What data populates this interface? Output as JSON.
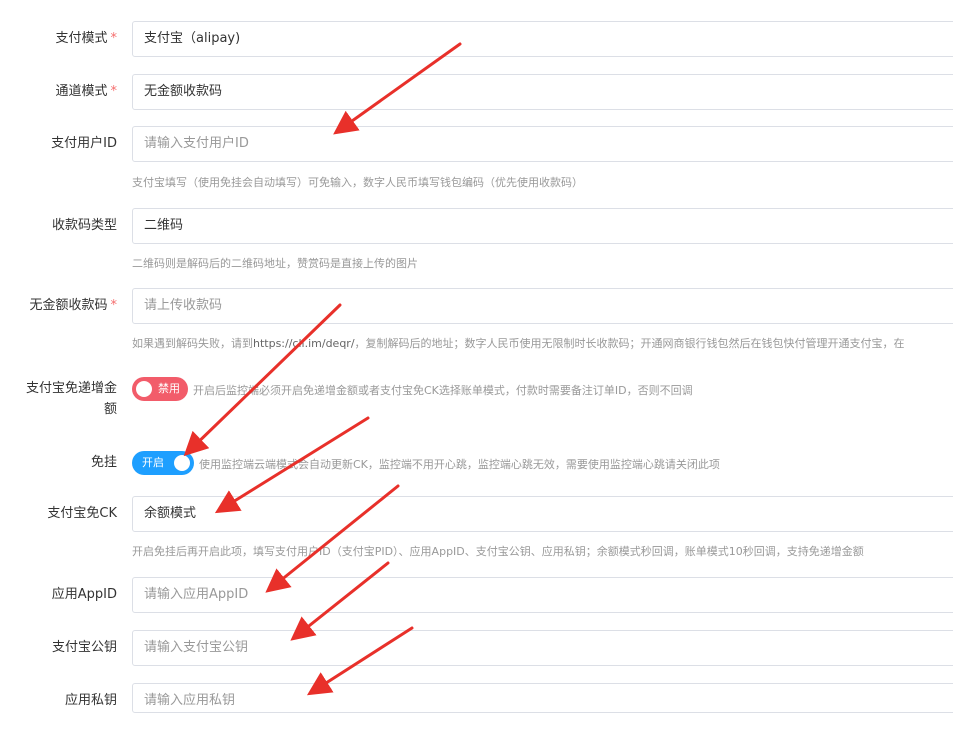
{
  "fields": {
    "pay_mode": {
      "label": "支付模式",
      "value": "支付宝（alipay)"
    },
    "channel_mode": {
      "label": "通道模式",
      "value": "无金额收款码"
    },
    "pay_user_id": {
      "label": "支付用户ID",
      "placeholder": "请输入支付用户ID",
      "help": "支付宝填写（使用免挂会自动填写）可免输入，数字人民币填写钱包编码（优先使用收款码）"
    },
    "qr_type": {
      "label": "收款码类型",
      "value": "二维码",
      "help": "二维码则是解码后的二维码地址，赞赏码是直接上传的图片"
    },
    "no_amount_qr": {
      "label": "无金额收款码",
      "placeholder": "请上传收款码",
      "help_prefix": "如果遇到解码失败，请到",
      "help_link": "https://cli.im/deqr/",
      "help_suffix": "，复制解码后的地址；数字人民币使用无限制时长收款码；开通网商银行钱包然后在钱包快付管理开通支付宝，在"
    },
    "alipay_free_increment": {
      "label_line1": "支付宝免递增金",
      "label_line2": "额",
      "switch_text": "禁用",
      "desc": "开启后监控端必须开启免递增金额或者支付宝免CK选择账单模式，付款时需要备注订单ID，否则不回调"
    },
    "free_hang": {
      "label": "免挂",
      "switch_text": "开启",
      "desc": "使用监控端云端模式会自动更新CK，监控端不用开心跳，监控端心跳无效，需要使用监控端心跳请关闭此项"
    },
    "alipay_free_ck": {
      "label": "支付宝免CK",
      "value": "余额模式",
      "help": "开启免挂后再开启此项，填写支付用户ID（支付宝PID）、应用AppID、支付宝公钥、应用私钥；余额模式秒回调，账单模式10秒回调，支持免递增金额"
    },
    "app_id": {
      "label": "应用AppID",
      "placeholder": "请输入应用AppID"
    },
    "alipay_public_key": {
      "label": "支付宝公钥",
      "placeholder": "请输入支付宝公钥"
    },
    "app_private_key": {
      "label": "应用私钥",
      "placeholder": "请输入应用私钥"
    }
  },
  "required_mark": "*",
  "colors": {
    "required": "#f56c6c",
    "switch_off": "#f25c6a",
    "switch_on": "#1e9fff",
    "arrow": "#e8302a"
  }
}
